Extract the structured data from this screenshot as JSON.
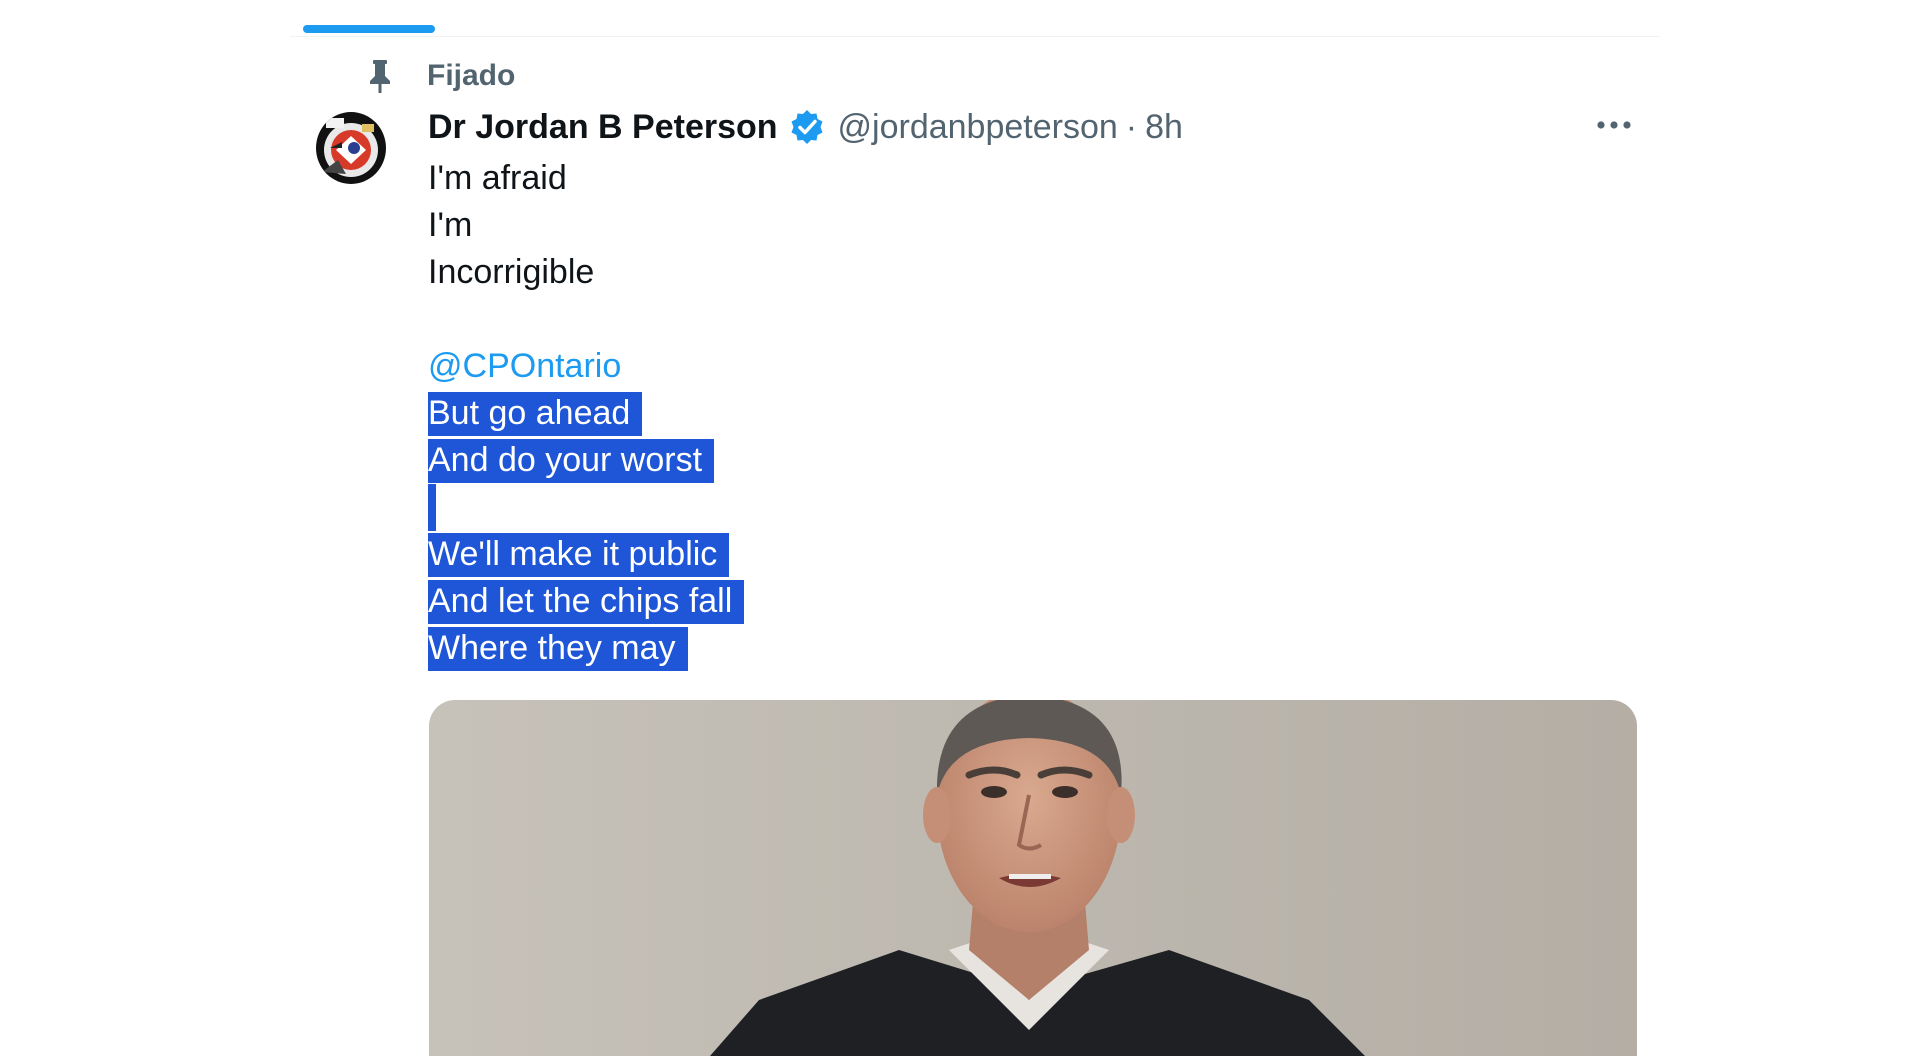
{
  "timeline": {
    "active_tab_color": "#1d9bf0"
  },
  "pinned": {
    "label": "Fijado",
    "icon": "pin-icon"
  },
  "tweet": {
    "author": {
      "display_name": "Dr Jordan B Peterson",
      "handle": "@jordanbpeterson",
      "verified": true,
      "verified_icon": "verified-badge-icon",
      "avatar_icon": "avatar"
    },
    "separator": "·",
    "time": "8h",
    "more_icon": "more-options-icon",
    "lines": {
      "l1": "I'm afraid",
      "l2": "I'm",
      "l3": "Incorrigible",
      "mention": "@CPOntario",
      "l5": "But go ahead",
      "l6": "And do your worst",
      "l8": "We'll make it public",
      "l9": "And let the chips fall",
      "l10": "Where they may"
    },
    "selection_color": "#1f56d7",
    "mention_color": "#1d9bf0",
    "media": {
      "type": "photo"
    }
  }
}
